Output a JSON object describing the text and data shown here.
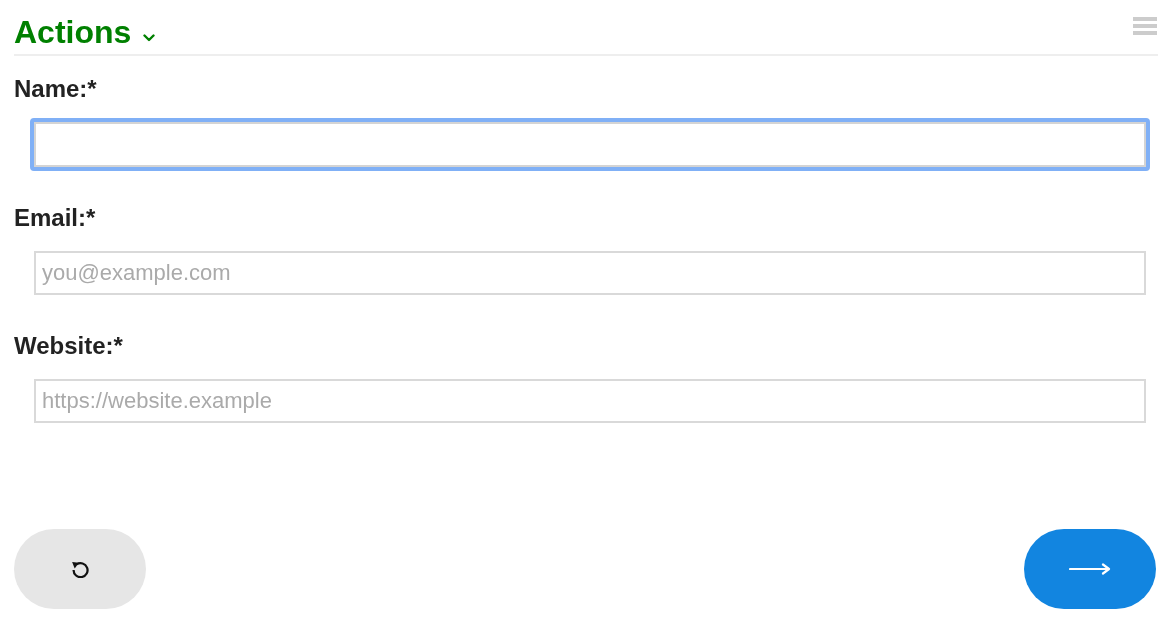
{
  "header": {
    "title": "Actions"
  },
  "fields": [
    {
      "label": "Name:*",
      "focused": true
    },
    {
      "label": "Email:*",
      "placeholder": "you@example.com",
      "focused": false
    },
    {
      "label": "Website:*",
      "placeholder": "https://website.example",
      "focused": false
    }
  ],
  "buttons": [
    {
      "kind": "reset"
    },
    {
      "kind": "submit"
    }
  ]
}
